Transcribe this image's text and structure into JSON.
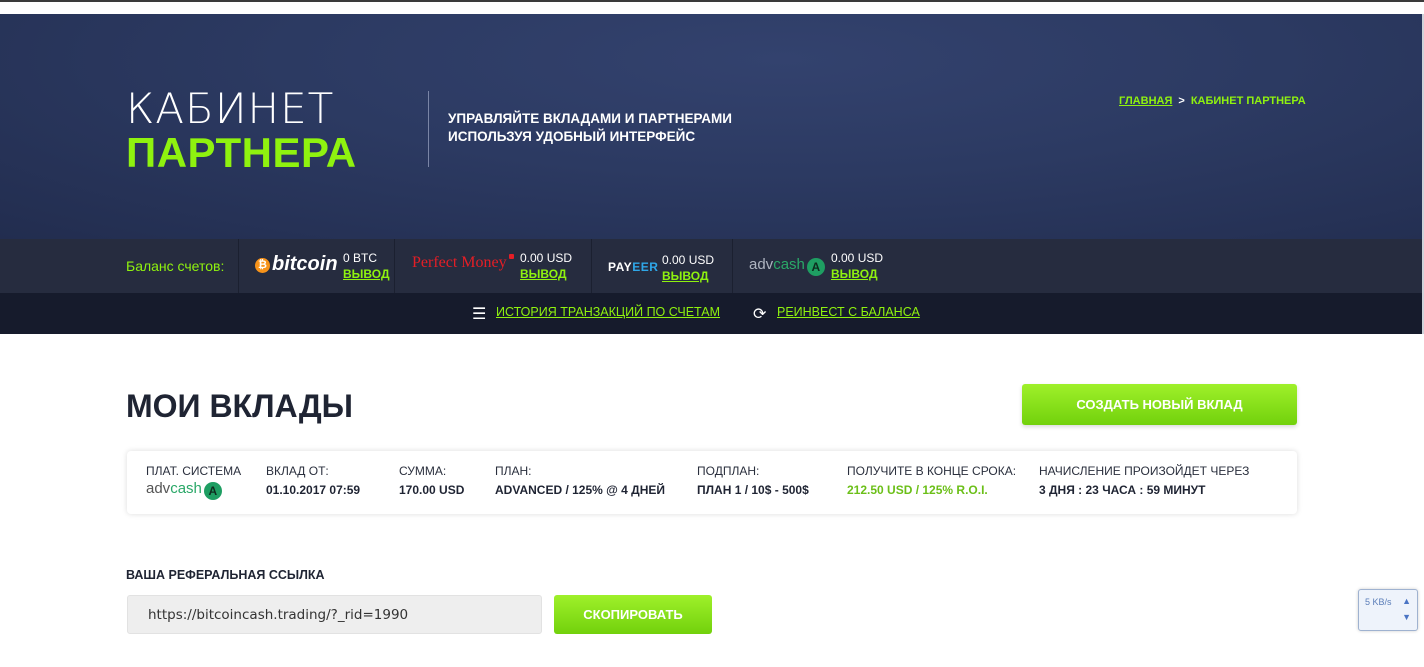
{
  "hero": {
    "title_line1": "КАБИНЕТ",
    "title_line2": "ПАРТНЕРА",
    "subtitle_line1": "УПРАВЛЯЙТЕ ВКЛАДАМИ И ПАРТНЕРАМИ",
    "subtitle_line2": "ИСПОЛЬЗУЯ УДОБНЫЙ ИНТЕРФЕЙС"
  },
  "breadcrumbs": {
    "home": "ГЛАВНАЯ",
    "separator": ">",
    "current": "КАБИНЕТ ПАРТНЕРА"
  },
  "balances": {
    "label": "Баланс счетов:",
    "items": [
      {
        "logo_text": "bitcoin",
        "amount": "0 BTC",
        "link": "ВЫВОД"
      },
      {
        "logo_text": "Perfect Money",
        "amount": "0.00 USD",
        "link": "ВЫВОД"
      },
      {
        "logo_text": "PAYEER",
        "logo_text_a": "PAY",
        "logo_text_b": "EER",
        "amount": "0.00 USD",
        "link": "ВЫВОД"
      },
      {
        "logo_text": "advcash",
        "logo_text_a": "adv",
        "logo_text_b": "cash",
        "amount": "0.00 USD",
        "link": "ВЫВОД"
      }
    ]
  },
  "subnav": {
    "history": "ИСТОРИЯ ТРАНЗАКЦИЙ ПО СЧЕТАМ",
    "reinvest": "РЕИНВЕСТ С БАЛАНСА",
    "history_icon": "menu-icon",
    "reinvest_icon": "refresh-icon"
  },
  "deposits": {
    "title": "МОИ ВКЛАДЫ",
    "create_button": "СОЗДАТЬ НОВЫЙ ВКЛАД",
    "columns": {
      "system": "ПЛАТ. СИСТЕМА",
      "date": "ВКЛАД ОТ:",
      "amount": "СУММА:",
      "plan": "ПЛАН:",
      "subplan": "ПОДПЛАН:",
      "result": "ПОЛУЧИТЕ В КОНЦЕ СРОКА:",
      "accrual": "НАЧИСЛЕНИЕ ПРОИЗОЙДЕТ ЧЕРЕЗ"
    },
    "row": {
      "system_a": "adv",
      "system_b": "cash",
      "date": "01.10.2017 07:59",
      "amount": "170.00 USD",
      "plan": "ADVANCED / 125% @ 4 ДНЕЙ",
      "subplan": "ПЛАН 1 / 10$ - 500$",
      "result": "212.50 USD / 125% R.O.I.",
      "accrual": "3 ДНЯ : 23 ЧАСА : 59 МИНУТ"
    }
  },
  "referral": {
    "label": "ВАША РЕФЕРАЛЬНАЯ ССЫЛКА",
    "value": "https://bitcoincash.trading/?_rid=1990",
    "copy_button": "СКОПИРОВАТЬ"
  },
  "net_widget": {
    "speed": "5 KB/s"
  },
  "colors": {
    "accent_green": "#8ff20f",
    "hero_bg": "#2c3a62",
    "balance_bar": "#262c3f",
    "subnav_bg": "#161b2c",
    "text_dark": "#1f2433"
  }
}
